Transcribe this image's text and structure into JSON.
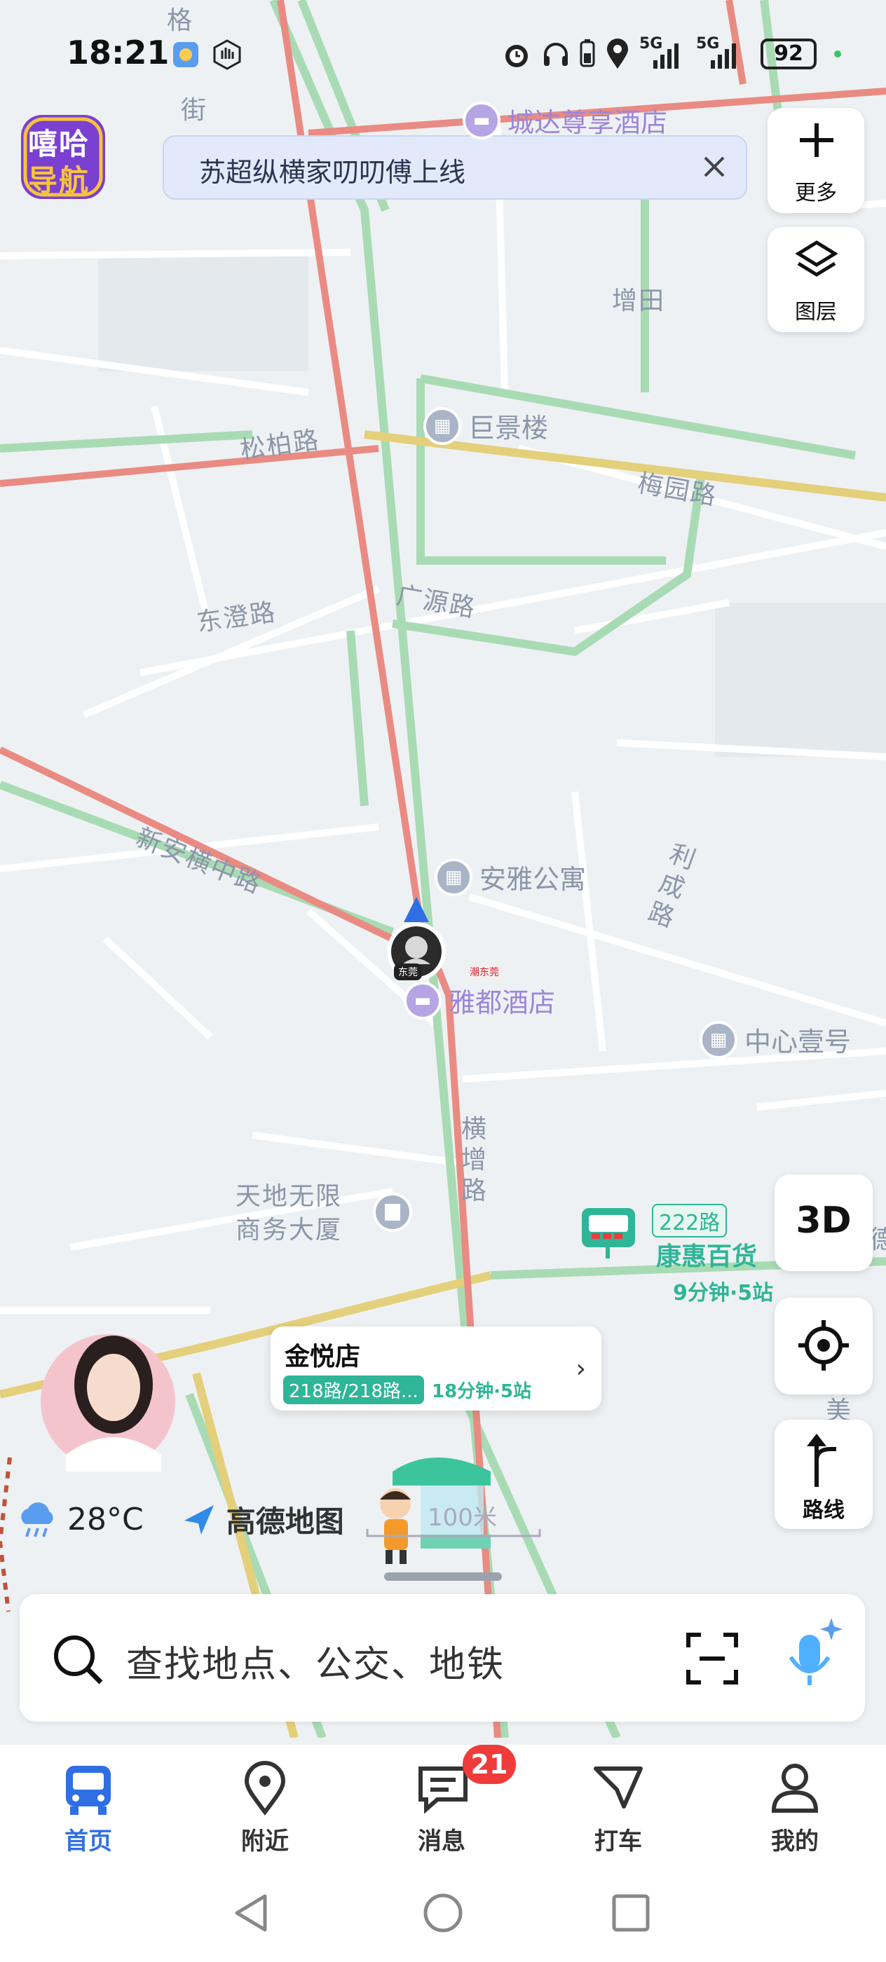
{
  "status_bar": {
    "time": "18:21",
    "network_1": "5G",
    "network_2": "5G",
    "battery": "92"
  },
  "app": {
    "logo_text_1": "嘻哈",
    "logo_text_2": "导航"
  },
  "notice": {
    "text": "苏超纵横家叨叨傅上线"
  },
  "map_controls": {
    "more_label": "更多",
    "layers_label": "图层",
    "three_d_label": "3D",
    "route_label": "路线"
  },
  "map": {
    "street_labels": [
      "格",
      "街",
      "松柏路",
      "东澄路",
      "广源路",
      "梅园路",
      "新安横中路",
      "利成路",
      "横增路",
      "增田",
      "天地无限",
      "商务大厦",
      "德",
      "美"
    ],
    "pois": [
      {
        "name": "城达尊享酒店",
        "type": "hotel"
      },
      {
        "name": "巨景楼",
        "type": "building"
      },
      {
        "name": "安雅公寓",
        "type": "building"
      },
      {
        "name": "雅都酒店",
        "type": "hotel"
      },
      {
        "name": "中心壹号",
        "type": "building"
      }
    ],
    "location_tags": [
      "东莞",
      "潮东莞"
    ],
    "bus_stop": {
      "route": "222路",
      "name": "康惠百货",
      "eta": "9分钟·5站"
    },
    "scale_label": "100米"
  },
  "stop_card": {
    "title": "金悦店",
    "routes": "218路/218路...",
    "eta": "18分钟·5站"
  },
  "weather": {
    "temperature": "28°C",
    "brand": "高德地图"
  },
  "search": {
    "placeholder": "查找地点、公交、地铁"
  },
  "tabs": [
    {
      "label": "首页",
      "icon": "bus-icon"
    },
    {
      "label": "附近",
      "icon": "location-pin-icon"
    },
    {
      "label": "消息",
      "icon": "message-icon"
    },
    {
      "label": "打车",
      "icon": "taxi-icon"
    },
    {
      "label": "我的",
      "icon": "person-icon"
    }
  ],
  "message_badge": "21",
  "colors": {
    "accent": "#2f6fe3",
    "transit_green": "#2fb597",
    "badge_red": "#ef3b3b"
  }
}
